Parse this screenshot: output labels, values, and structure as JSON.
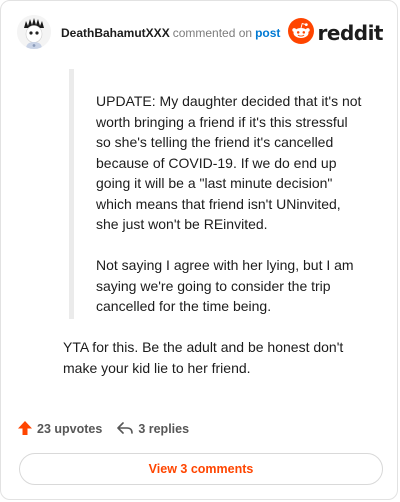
{
  "header": {
    "username": "DeathBahamutXXX",
    "verb": "commented on",
    "post_link": "post",
    "brand": "reddit"
  },
  "quote": {
    "paragraphs": [
      "UPDATE: My daughter decided that it's not worth bringing a friend if it's this stressful so she's telling the friend it's cancelled because of COVID-19. If we do end up going it will be a \"last minute decision\" which means that friend isn't UNinvited, she just won't be REinvited.",
      "Not saying I agree with her lying, but I am saying we're going to consider the trip cancelled for the time being."
    ]
  },
  "comment": {
    "body": "YTA for this. Be the adult and be honest don't make your kid lie to her friend."
  },
  "actions": {
    "upvotes": "23 upvotes",
    "replies": "3 replies"
  },
  "view_button": "View 3 comments",
  "colors": {
    "accent": "#ff4500",
    "link": "#0079d3",
    "muted": "#7c7c7c",
    "quote_bar": "#ebebeb"
  },
  "icons": {
    "upvote": "upvote-arrow-icon",
    "reply": "reply-arrow-icon",
    "brand": "reddit-snoo-icon",
    "avatar": "user-avatar"
  }
}
